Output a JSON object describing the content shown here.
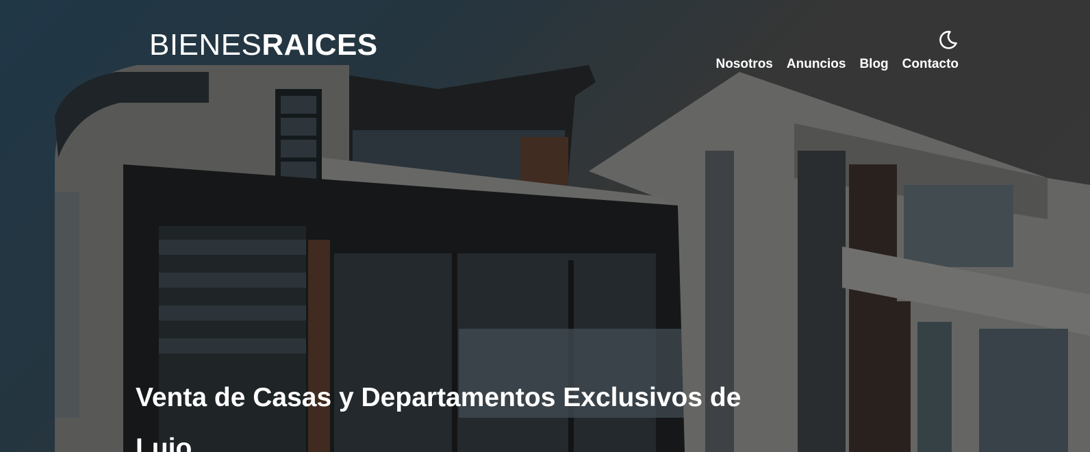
{
  "header": {
    "logo": {
      "light_part": "BIENES",
      "bold_part": "RAICES"
    },
    "dark_mode_toggle": {
      "icon": "moon-icon"
    },
    "nav": {
      "items": [
        {
          "label": "Nosotros"
        },
        {
          "label": "Anuncios"
        },
        {
          "label": "Blog"
        },
        {
          "label": "Contacto"
        }
      ]
    }
  },
  "hero": {
    "headline": "Venta de Casas y Departamentos Exclusivos de Lujo"
  },
  "colors": {
    "text": "#ffffff",
    "overlay": "rgba(0,0,0,0.28)",
    "sky_blue": "#2d4d62",
    "sky_gray": "#4e4e4e"
  }
}
